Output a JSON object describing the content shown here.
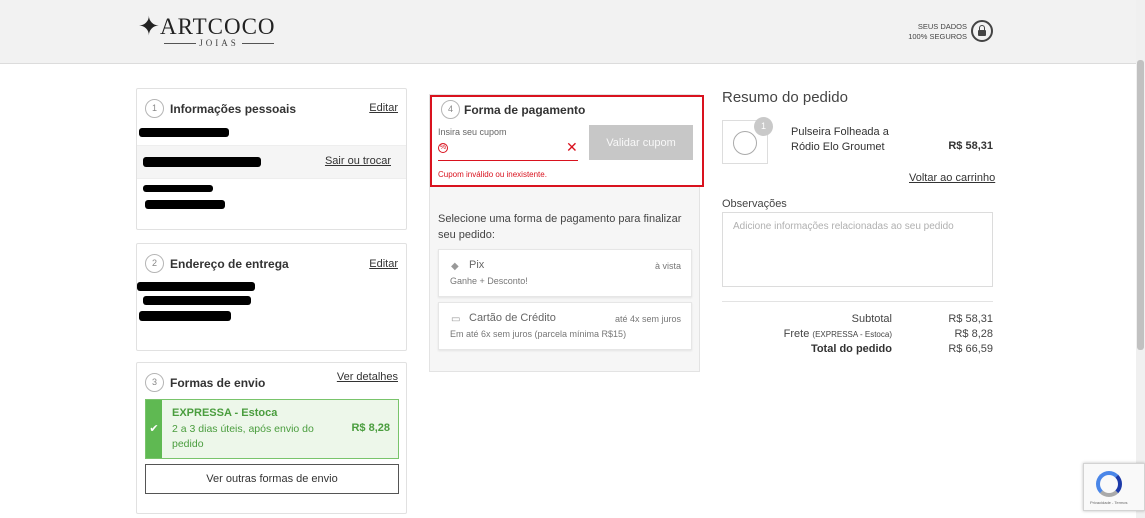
{
  "header": {
    "logo_text": "ARTCOCO",
    "logo_sub": "JOIAS",
    "secure_line1": "SEUS DADOS",
    "secure_line2": "100% SEGUROS"
  },
  "steps": [
    {
      "number": "1",
      "title": "Informações pessoais",
      "action": "Editar",
      "secondary_action": "Sair ou trocar"
    },
    {
      "number": "2",
      "title": "Endereço de entrega",
      "action": "Editar"
    },
    {
      "number": "3",
      "title": "Formas de envio",
      "action": "Ver detalhes",
      "option": {
        "name": "EXPRESSA - Estoca",
        "description": "2 a 3 dias úteis, após envio do pedido",
        "price": "R$ 8,28"
      },
      "other_button": "Ver outras formas de envio"
    },
    {
      "number": "4",
      "title": "Forma de pagamento"
    }
  ],
  "payment": {
    "coupon_label": "Insira seu cupom",
    "coupon_value": "",
    "coupon_button": "Validar cupom",
    "coupon_error": "Cupom inválido ou inexistente.",
    "instructions": "Selecione uma forma de pagamento para finalizar seu pedido:",
    "options": [
      {
        "name": "Pix",
        "note": "à vista",
        "description": "Ganhe + Desconto!",
        "icon": "pix-icon"
      },
      {
        "name": "Cartão de Crédito",
        "note": "até 4x sem juros",
        "description": "Em até 6x sem juros (parcela mínima R$15)",
        "icon": "credit-card-icon"
      }
    ]
  },
  "summary": {
    "title": "Resumo do pedido",
    "product": {
      "qty": "1",
      "name": "Pulseira Folheada a Ródio Elo Groumet",
      "price": "R$ 58,31"
    },
    "back_link": "Voltar ao carrinho",
    "observations_label": "Observações",
    "observations_placeholder": "Adicione informações relacionadas ao seu pedido",
    "subtotal_label": "Subtotal",
    "subtotal_value": "R$ 58,31",
    "shipping_label": "Frete",
    "shipping_detail": "(EXPRESSA - Estoca)",
    "shipping_value": "R$ 8,28",
    "total_label": "Total do pedido",
    "total_value": "R$ 66,59"
  },
  "recaptcha": {
    "text": "Privacidade - Termos"
  }
}
